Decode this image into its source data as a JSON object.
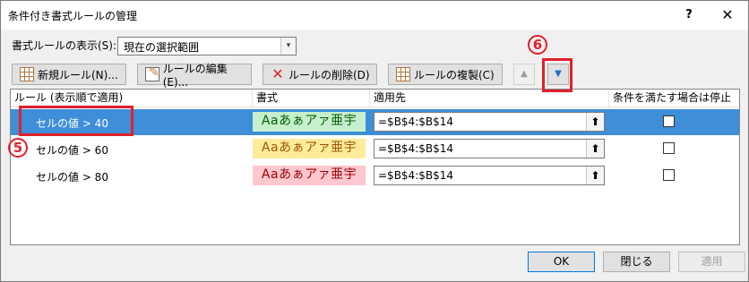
{
  "window": {
    "title": "条件付き書式ルールの管理",
    "help_glyph": "?",
    "close_glyph": "✕"
  },
  "show_rules": {
    "label": "書式ルールの表示(S):",
    "selected": "現在の選択範囲",
    "dropdown_glyph": "▾"
  },
  "toolbar": {
    "new_rule": "新規ルール(N)...",
    "edit_rule": "ルールの編集(E)...",
    "delete_rule": "ルールの削除(D)",
    "duplicate_rule": "ルールの複製(C)",
    "move_up_glyph": "▲",
    "move_down_glyph": "▼",
    "delete_glyph": "✕"
  },
  "table": {
    "headers": {
      "rule": "ルール (表示順で適用)",
      "format": "書式",
      "applies_to": "適用先",
      "stop_if_true": "条件を満たす場合は停止"
    },
    "rows": [
      {
        "rule": "セルの値 > 40",
        "preview": "Aaあぁアァ亜宇",
        "applies_to": "=$B$4:$B$14",
        "fill": "#c6efce",
        "text_color": "#006100",
        "selected": true
      },
      {
        "rule": "セルの値 > 60",
        "preview": "Aaあぁアァ亜宇",
        "applies_to": "=$B$4:$B$14",
        "fill": "#ffeb9c",
        "text_color": "#9c5700",
        "selected": false
      },
      {
        "rule": "セルの値 > 80",
        "preview": "Aaあぁアァ亜宇",
        "applies_to": "=$B$4:$B$14",
        "fill": "#ffc7ce",
        "text_color": "#9c0006",
        "selected": false
      }
    ],
    "range_picker_glyph": "⬆"
  },
  "annotations": {
    "step5": "5",
    "step6": "6",
    "highlight_color": "#e0202a"
  },
  "buttons": {
    "ok": "OK",
    "close": "閉じる",
    "apply": "適用"
  }
}
